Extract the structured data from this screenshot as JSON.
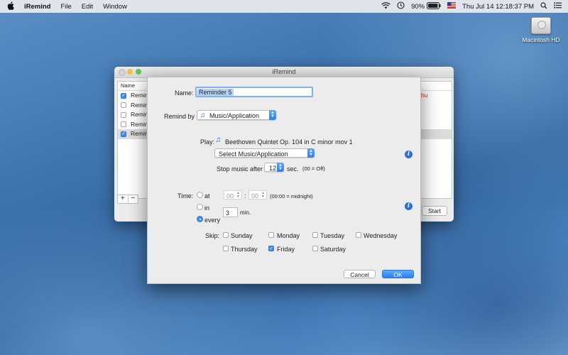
{
  "menubar": {
    "apple_icon": "apple-icon",
    "app_name": "iRemind",
    "menus": [
      "File",
      "Edit",
      "Window"
    ],
    "battery": "90%",
    "clock": "Thu Jul 14  12:18:37 PM"
  },
  "desktop": {
    "disk_label": "Macintosh HD"
  },
  "main_window": {
    "title": "iRemind",
    "column_header": "Name",
    "rows": [
      {
        "label": "Remind",
        "checked": true
      },
      {
        "label": "Remind",
        "checked": false
      },
      {
        "label": "Remind",
        "checked": false
      },
      {
        "label": "Remind",
        "checked": false
      },
      {
        "label": "Remind",
        "checked": true
      }
    ],
    "clipped_text": "hu",
    "add_label": "+",
    "remove_label": "−",
    "start_label": "Start"
  },
  "dialog": {
    "name_label": "Name:",
    "name_value": "Reminder 5",
    "remind_by_label": "Remind by",
    "remind_by_value": "Music/Application",
    "play_label": "Play:",
    "play_value": "Beethoven Quintet Op. 104 in C minor mov 1",
    "select_music_label": "Select Music/Application",
    "stop_after_label": "Stop music after",
    "stop_after_value": "12",
    "stop_after_unit": "sec.",
    "stop_after_hint": "(00 = Off)",
    "time_label": "Time:",
    "time_option_at": "at",
    "time_option_in": "in",
    "time_option_every": "every",
    "hours_value": "00",
    "minutes_value": "00",
    "time_separator": ":",
    "midnight_hint": "(00:00 = midnight)",
    "interval_value": "3",
    "interval_unit": "min.",
    "skip_label": "Skip:",
    "days": [
      {
        "label": "Sunday",
        "checked": false
      },
      {
        "label": "Monday",
        "checked": false
      },
      {
        "label": "Tuesday",
        "checked": false
      },
      {
        "label": "Wednesday",
        "checked": false
      },
      {
        "label": "Thursday",
        "checked": false
      },
      {
        "label": "Friday",
        "checked": true
      },
      {
        "label": "Saturday",
        "checked": false
      }
    ],
    "cancel_label": "Cancel",
    "ok_label": "OK",
    "info_glyph": "i"
  },
  "colors": {
    "accent": "#3b8ef0",
    "info": "#2c6fd6"
  }
}
